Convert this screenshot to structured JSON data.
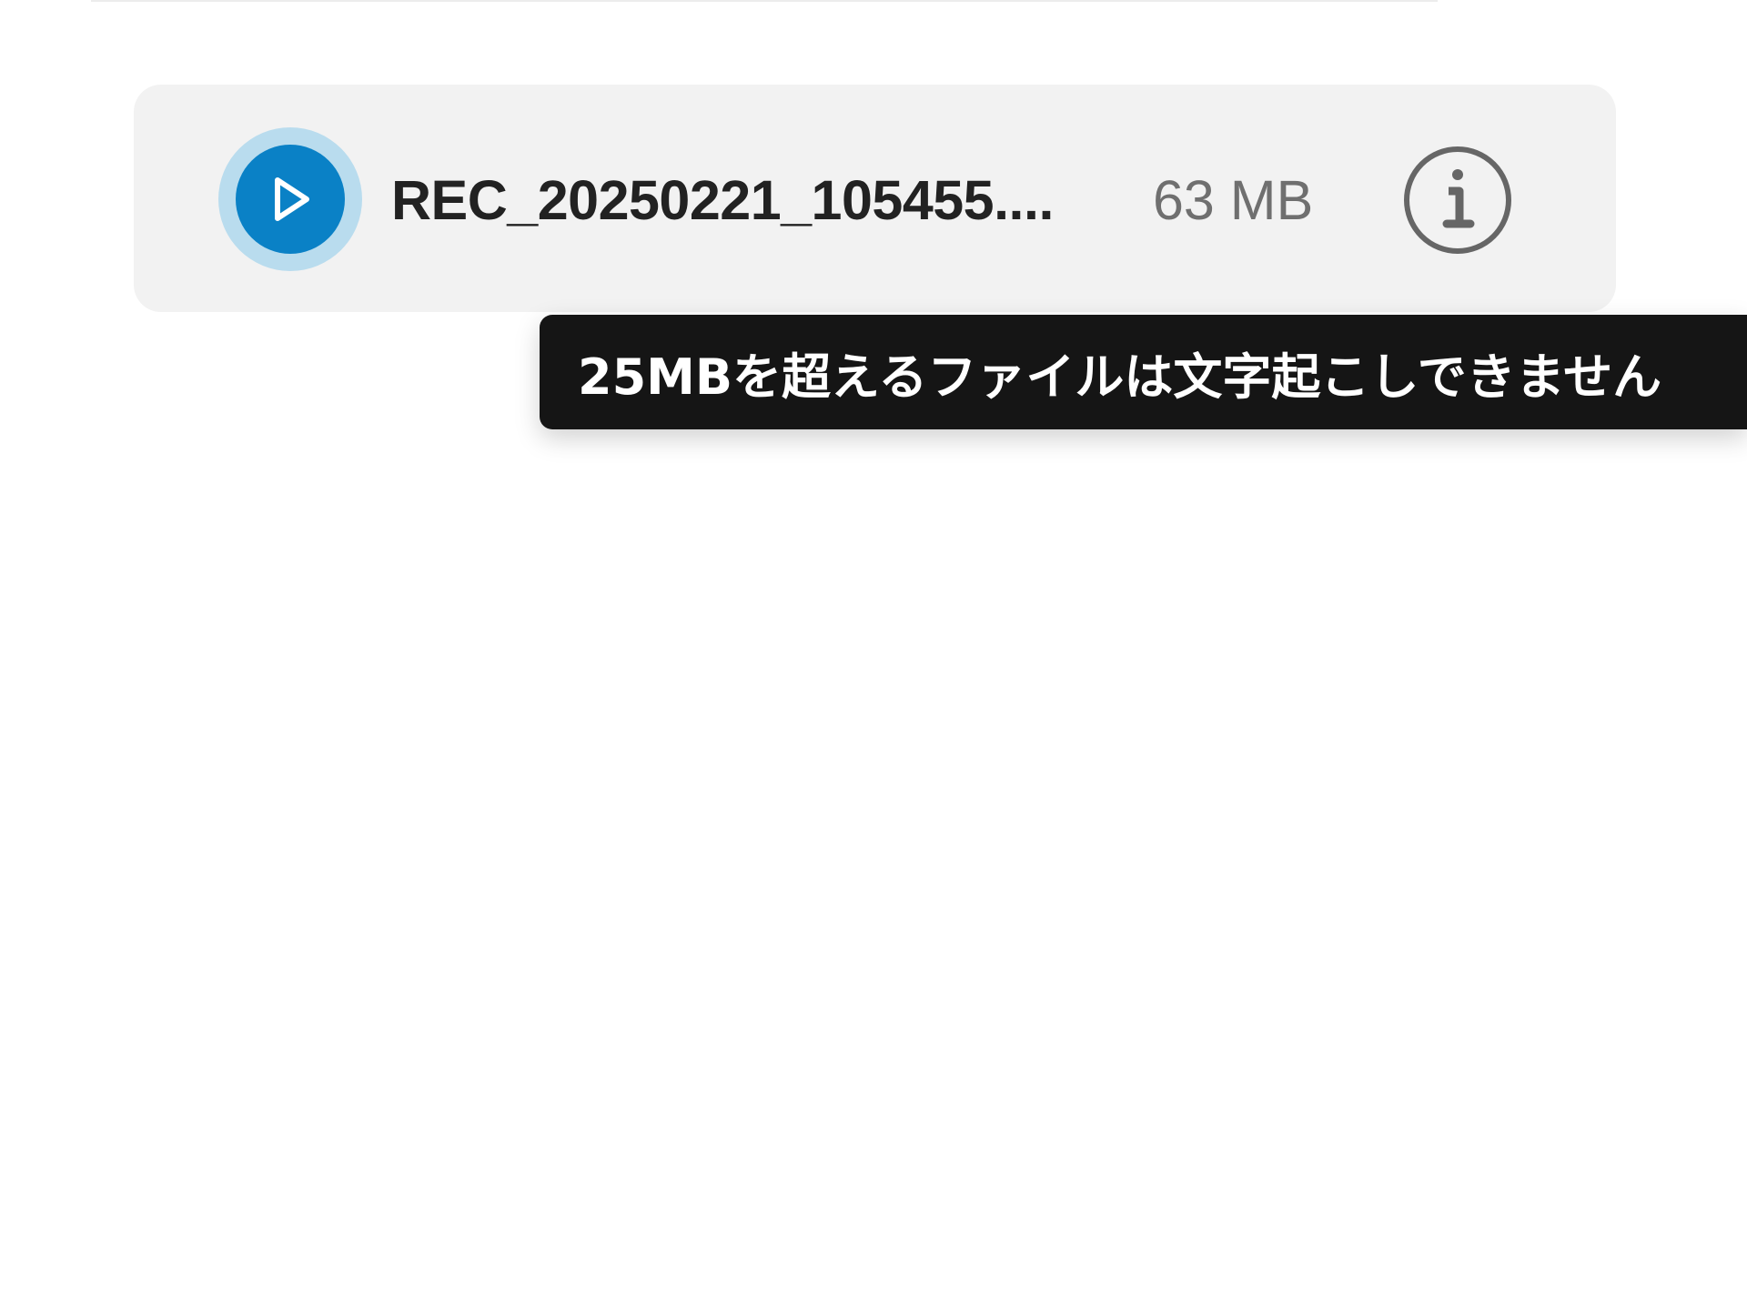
{
  "file": {
    "name": "REC_20250221_105455....",
    "size": "63 MB",
    "play_icon": "play-icon",
    "info_icon": "info-icon"
  },
  "tooltip": {
    "text": "25MBを超えるファイルは文字起こしできません"
  },
  "colors": {
    "card_background": "#f2f2f2",
    "play_accent": "#0a81c6",
    "play_ring": "#b9dcee",
    "tooltip_background": "#151515"
  }
}
